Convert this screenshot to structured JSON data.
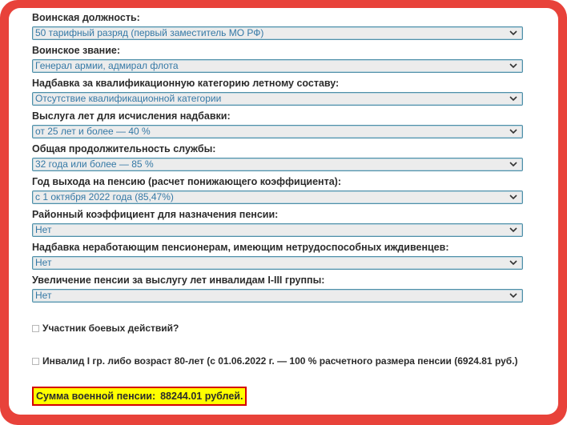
{
  "fields": [
    {
      "label": "Воинская должность:",
      "value": "50 тарифный разряд (первый заместитель МО РФ)"
    },
    {
      "label": "Воинское звание:",
      "value": "Генерал армии, адмирал флота"
    },
    {
      "label": "Надбавка за квалификационную категорию летному составу:",
      "value": "Отсутствие квалификационной категории"
    },
    {
      "label": "Выслуга лет для исчисления надбавки:",
      "value": "от 25 лет и более — 40 %"
    },
    {
      "label": "Общая продолжительность службы:",
      "value": "32 года или более — 85 %"
    },
    {
      "label": "Год выхода на пенсию (расчет понижающего коэффициента):",
      "value": "с 1 октября 2022 года (85,47%)"
    },
    {
      "label": "Районный коэффициент для назначения пенсии:",
      "value": "Нет"
    },
    {
      "label": "Надбавка неработающим пенсионерам, имеющим нетрудоспособных иждивенцев:",
      "value": "Нет"
    },
    {
      "label": "Увеличение пенсии за выслугу лет инвалидам I-III группы:",
      "value": "Нет"
    }
  ],
  "checkboxes": [
    {
      "label": "Участник боевых действий?",
      "checked": false
    },
    {
      "label": "Инвалид I гр. либо возраст 80-лет (с 01.06.2022 г. — 100 % расчетного размера пенсии (6924.81 руб.)",
      "checked": false
    }
  ],
  "result": {
    "label": "Сумма военной пенсии:",
    "amount": "88244.01 рублей."
  },
  "colors": {
    "frame": "#e8423a",
    "select_text": "#3579a6",
    "select_border": "#4f8fa8",
    "highlight": "#ffff00",
    "highlight_border": "#d40000"
  },
  "icons": {
    "select_arrow": "chevron-down-icon"
  }
}
